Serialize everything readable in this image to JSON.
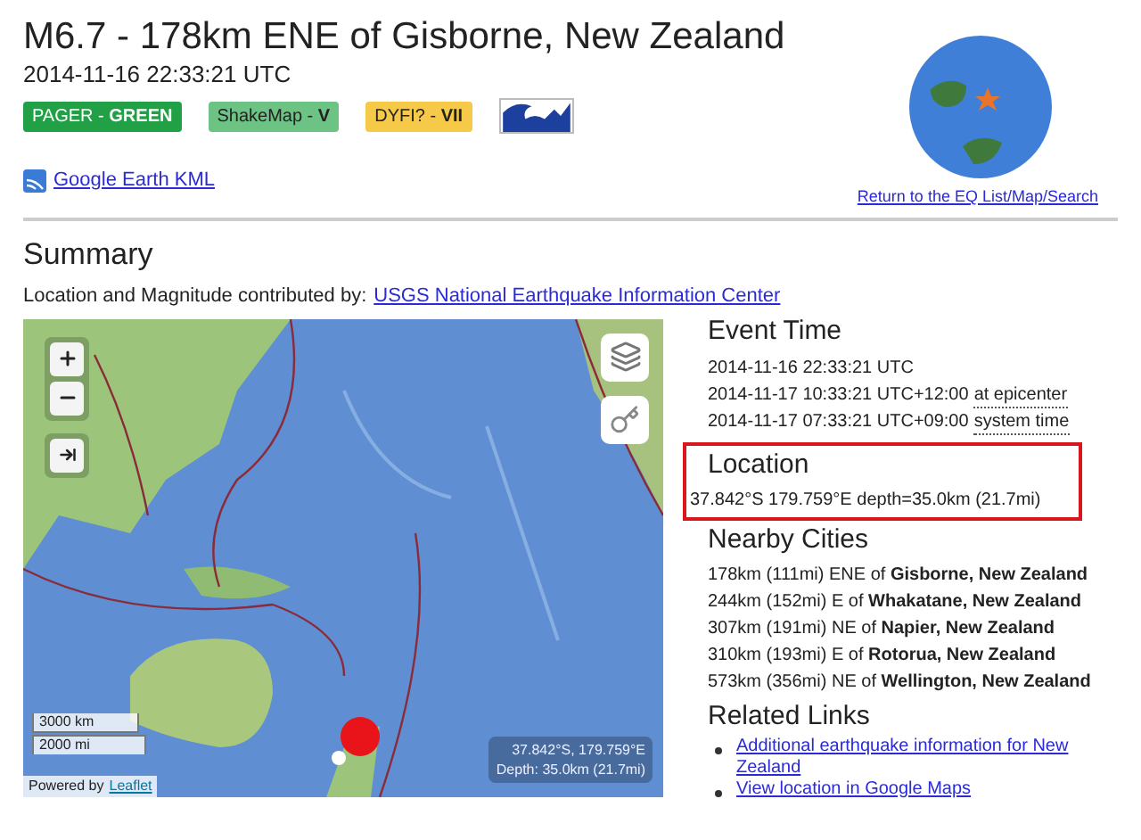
{
  "title": "M6.7 - 178km ENE of Gisborne, New Zealand",
  "time": "2014-11-16 22:33:21 UTC",
  "badges": [
    {
      "kind": "text",
      "text": "PAGER - **GREEN**",
      "color": "#22a046"
    },
    {
      "kind": "text",
      "text": "ShakeMap - **V**",
      "color": "#6cc383"
    },
    {
      "kind": "text",
      "text": "DYFI? - **VII**",
      "color": "#f7c948"
    },
    {
      "kind": "tsunami"
    }
  ],
  "kml_link": "Google Earth KML",
  "return_link": "Return to the EQ List/Map/Search",
  "summary": {
    "heading": "Summary",
    "contributed_label": "Location and Magnitude contributed by:",
    "contributed_link": "USGS National Earthquake Information Center"
  },
  "map": {
    "scale_km": "3000 km",
    "scale_mi": "2000 mi",
    "attribution": "Powered by",
    "attribution_link": "Leaflet",
    "coords": "37.842°S, 179.759°E",
    "depth": "Depth: 35.0km (21.7mi)"
  },
  "event_time": {
    "heading": "Event Time",
    "lines": [
      {
        "text": "2014-11-16 22:33:21 UTC"
      },
      {
        "text": "2014-11-17 10:33:21 UTC+12:00",
        "note": "at epicenter"
      },
      {
        "text": "2014-11-17 07:33:21 UTC+09:00",
        "note": "system time"
      }
    ]
  },
  "location": {
    "heading": "Location",
    "text": "37.842°S 179.759°E depth=35.0km (21.7mi)",
    "highlighted": true
  },
  "nearby": {
    "heading": "Nearby Cities",
    "cities": [
      "178km (111mi) ENE of **Gisborne, New Zealand**",
      "244km (152mi) E of **Whakatane, New Zealand**",
      "307km (191mi) NE of **Napier, New Zealand**",
      "310km (193mi) E of **Rotorua, New Zealand**",
      "573km (356mi) NE of **Wellington, New Zealand**"
    ]
  },
  "related": {
    "heading": "Related Links",
    "links": [
      "Additional earthquake information for New Zealand",
      "View location in Google Maps"
    ]
  }
}
